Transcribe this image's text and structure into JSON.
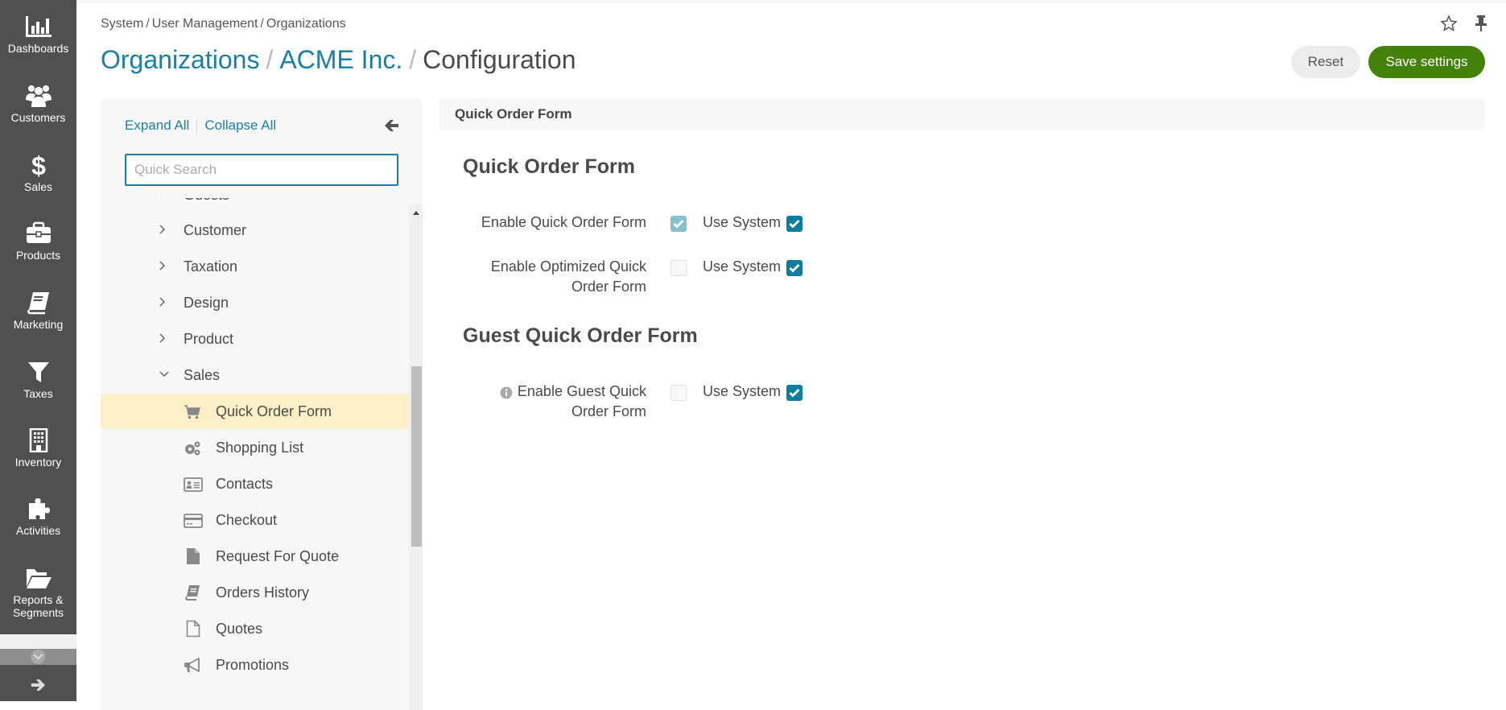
{
  "nav": {
    "items": [
      {
        "label": "Dashboards",
        "icon": "bar-chart-icon"
      },
      {
        "label": "Customers",
        "icon": "users-icon"
      },
      {
        "label": "Sales",
        "icon": "dollar-icon"
      },
      {
        "label": "Products",
        "icon": "briefcase-icon"
      },
      {
        "label": "Marketing",
        "icon": "book-icon"
      },
      {
        "label": "Taxes",
        "icon": "filter-icon"
      },
      {
        "label": "Inventory",
        "icon": "building-icon"
      },
      {
        "label": "Activities",
        "icon": "puzzle-icon"
      },
      {
        "label": "Reports &",
        "label2": "Segments",
        "icon": "folder-open-icon"
      }
    ]
  },
  "header": {
    "breadcrumb": [
      "System",
      "User Management",
      "Organizations"
    ],
    "breadcrumb_sep": "/",
    "title": {
      "parts": [
        "Organizations",
        "ACME Inc.",
        "Configuration"
      ],
      "sep": "/"
    },
    "reset_label": "Reset",
    "save_label": "Save settings"
  },
  "tree": {
    "expand_all": "Expand All",
    "collapse_all": "Collapse All",
    "search_placeholder": "Quick Search",
    "search_value": "",
    "items": [
      {
        "label": "Guests",
        "level": 0,
        "expanded": false
      },
      {
        "label": "Customer",
        "level": 0,
        "expanded": false
      },
      {
        "label": "Taxation",
        "level": 0,
        "expanded": false
      },
      {
        "label": "Design",
        "level": 0,
        "expanded": false
      },
      {
        "label": "Product",
        "level": 0,
        "expanded": false
      },
      {
        "label": "Sales",
        "level": 0,
        "expanded": true
      },
      {
        "label": "Quick Order Form",
        "level": 1,
        "icon": "cart-icon",
        "selected": true
      },
      {
        "label": "Shopping List",
        "level": 1,
        "icon": "cogs-icon"
      },
      {
        "label": "Contacts",
        "level": 1,
        "icon": "id-card-icon"
      },
      {
        "label": "Checkout",
        "level": 1,
        "icon": "credit-card-icon"
      },
      {
        "label": "Request For Quote",
        "level": 1,
        "icon": "file-icon"
      },
      {
        "label": "Orders History",
        "level": 1,
        "icon": "book-icon"
      },
      {
        "label": "Quotes",
        "level": 1,
        "icon": "file-outline-icon"
      },
      {
        "label": "Promotions",
        "level": 1,
        "icon": "bullhorn-icon"
      }
    ]
  },
  "content": {
    "header_title": "Quick Order Form",
    "sections": [
      {
        "title": "Quick Order Form",
        "fields": [
          {
            "label_line1": "Enable Quick Order Form",
            "label_line2": "",
            "value": true,
            "disabled": true,
            "use_system_label": "Use System",
            "use_system": true
          },
          {
            "label_line1": "Enable Optimized Quick",
            "label_line2": "Order Form",
            "value": false,
            "disabled": true,
            "use_system_label": "Use System",
            "use_system": true
          }
        ]
      },
      {
        "title": "Guest Quick Order Form",
        "fields": [
          {
            "label_line1": "Enable Guest Quick",
            "label_line2": "Order Form",
            "value": false,
            "disabled": true,
            "has_info": true,
            "use_system_label": "Use System",
            "use_system": true
          }
        ]
      }
    ]
  },
  "colors": {
    "accent": "#1a7fa3",
    "save_button": "#438108",
    "checkbox_checked": "#0c7d9c",
    "checkbox_disabled_checked": "#87c0cf",
    "selected_row": "#fdefc6",
    "sidebar": "#505050"
  }
}
